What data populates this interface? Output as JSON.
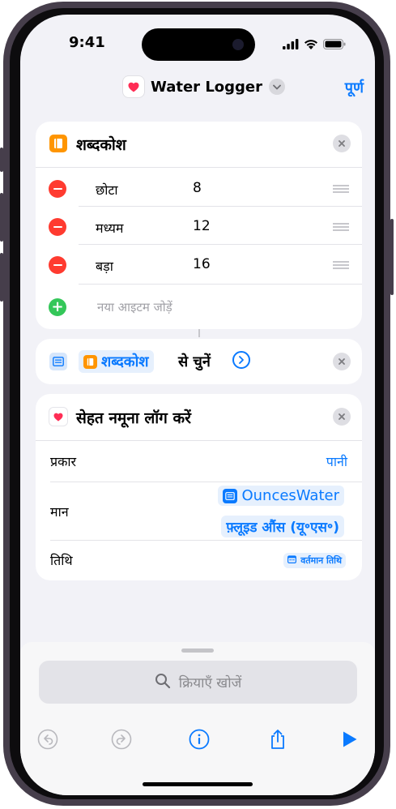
{
  "status_bar": {
    "time": "9:41"
  },
  "nav": {
    "title": "Water Logger",
    "done_label": "पूर्ण"
  },
  "dictionary_card": {
    "title": "शब्दकोश",
    "items": [
      {
        "key": "छोटा",
        "value": "8"
      },
      {
        "key": "मध्यम",
        "value": "12"
      },
      {
        "key": "बड़ा",
        "value": "16"
      }
    ],
    "add_placeholder": "नया आइटम जोड़ें"
  },
  "choose_card": {
    "token_label": "शब्दकोश",
    "action_text": "से चुनें"
  },
  "health_card": {
    "title": "सेहत नमूना लॉग करें",
    "type_label": "प्रकार",
    "type_value": "पानी",
    "value_label": "मान",
    "value_token": "OuncesWater",
    "value_unit": "फ़्लूइड औंस (यू॰एस॰)",
    "date_label": "तिथि",
    "date_token": "वर्तमान तिथि"
  },
  "bottom_sheet": {
    "search_placeholder": "क्रियाएँ खोजें"
  },
  "colors": {
    "accent": "#0a7aff",
    "remove": "#ff3b30",
    "add": "#34c759",
    "dictionary": "#ff9500",
    "health": "#ff2d55"
  },
  "icons": [
    "search-icon",
    "undo-icon",
    "redo-icon",
    "info-icon",
    "share-icon",
    "play-icon",
    "close-icon",
    "chevron-down-icon",
    "wifi-icon",
    "battery-icon",
    "signal-icon"
  ]
}
